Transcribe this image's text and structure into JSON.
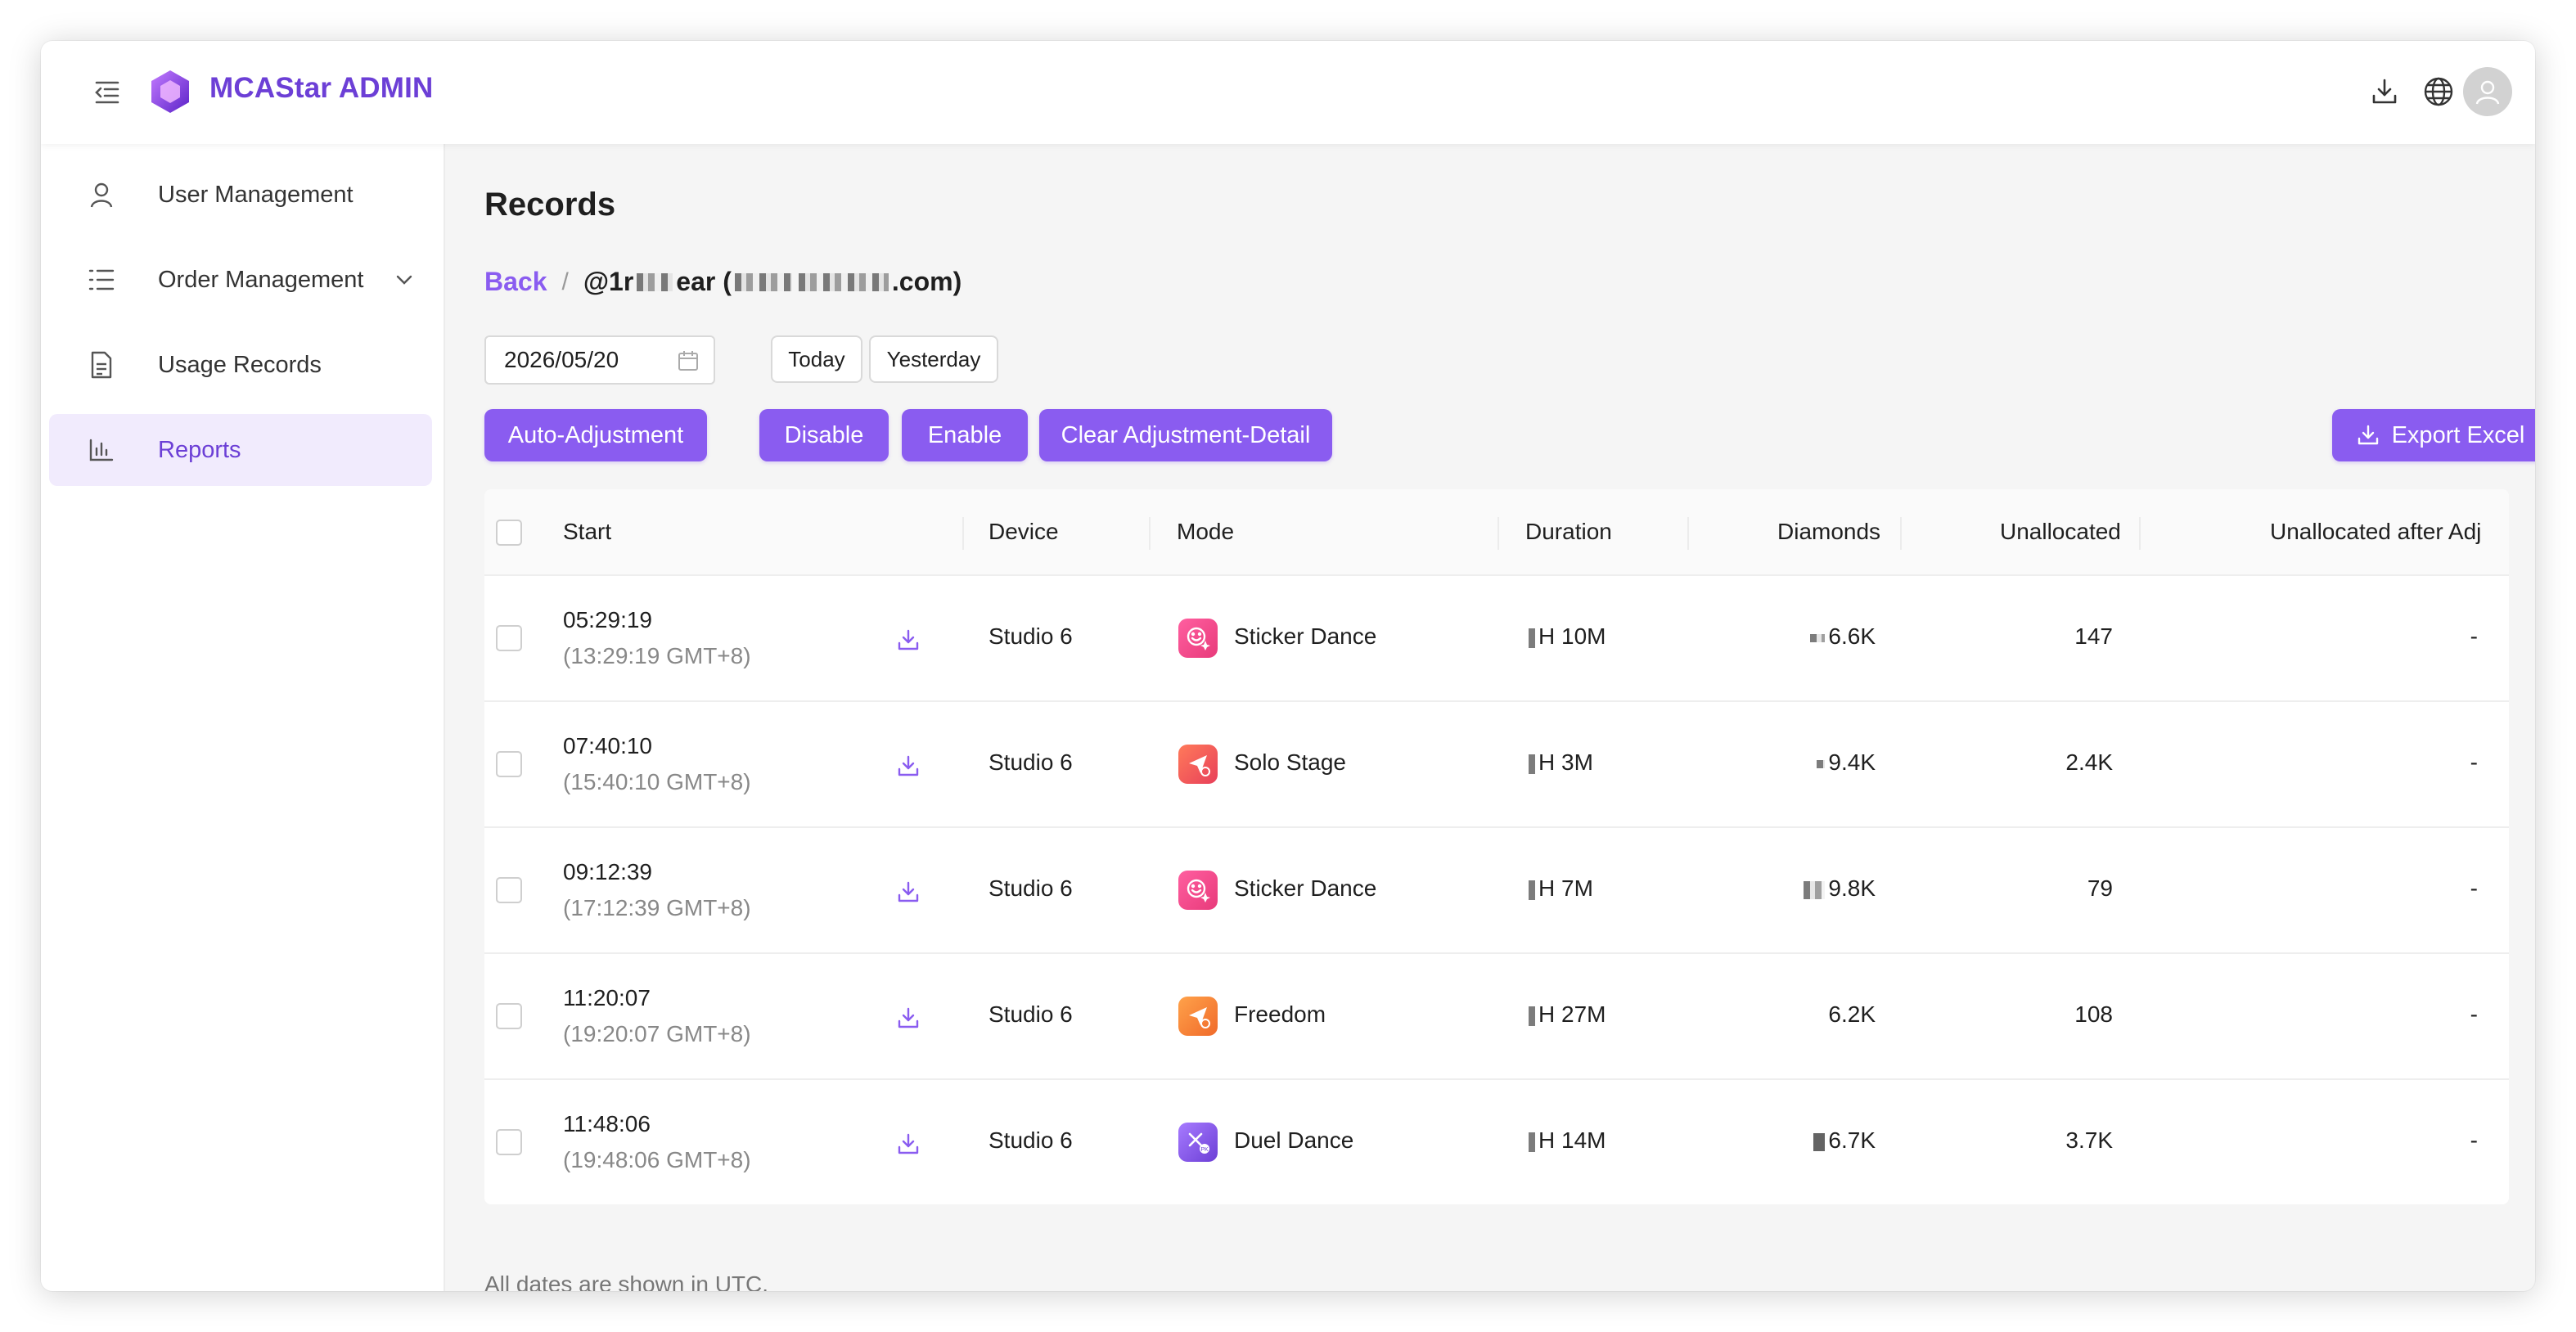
{
  "header": {
    "app_title": "MCAStar ADMIN",
    "icons": [
      "menu-fold-icon",
      "hexagon-logo-icon",
      "download-icon",
      "globe-icon",
      "user-avatar-icon"
    ]
  },
  "sidebar": {
    "items": [
      {
        "label": "User Management",
        "icon": "user-icon",
        "active": false
      },
      {
        "label": "Order Management",
        "icon": "list-icon",
        "active": false,
        "expandable": true
      },
      {
        "label": "Usage Records",
        "icon": "document-icon",
        "active": false
      },
      {
        "label": "Reports",
        "icon": "bar-chart-icon",
        "active": true
      }
    ]
  },
  "main": {
    "title": "Records",
    "breadcrumb": {
      "back": "Back",
      "separator": "/",
      "user_prefix": "@1r",
      "user_mid": "ear (",
      "user_suffix": ".com)"
    },
    "date_value": "2026/05/20",
    "quick_dates": [
      "Today",
      "Yesterday"
    ],
    "actions": {
      "auto_adjustment": "Auto-Adjustment",
      "disable": "Disable",
      "enable": "Enable",
      "clear_adjustment": "Clear Adjustment-Detail",
      "export_excel": "Export Excel"
    },
    "table": {
      "columns": {
        "start": "Start",
        "device": "Device",
        "mode": "Mode",
        "duration": "Duration",
        "diamonds": "Diamonds",
        "unallocated": "Unallocated",
        "unallocated_after": "Unallocated after Adj"
      },
      "rows": [
        {
          "time": "05:29:19",
          "local": "(13:29:19 GMT+8)",
          "device": "Studio 6",
          "mode": "Sticker Dance",
          "mode_color": "#f0508a",
          "duration": "H 10M",
          "diamonds": "6.6K",
          "unallocated": "147",
          "after": "-"
        },
        {
          "time": "07:40:10",
          "local": "(15:40:10 GMT+8)",
          "device": "Studio 6",
          "mode": "Solo Stage",
          "mode_color": "#f36a4a",
          "duration": "H 3M",
          "diamonds": "9.4K",
          "unallocated": "2.4K",
          "after": "-"
        },
        {
          "time": "09:12:39",
          "local": "(17:12:39 GMT+8)",
          "device": "Studio 6",
          "mode": "Sticker Dance",
          "mode_color": "#f0508a",
          "duration": "H 7M",
          "diamonds": "9.8K",
          "unallocated": "79",
          "after": "-"
        },
        {
          "time": "11:20:07",
          "local": "(19:20:07 GMT+8)",
          "device": "Studio 6",
          "mode": "Freedom",
          "mode_color": "#f5883a",
          "duration": "H 27M",
          "diamonds": "6.2K",
          "unallocated": "108",
          "after": "-"
        },
        {
          "time": "11:48:06",
          "local": "(19:48:06 GMT+8)",
          "device": "Studio 6",
          "mode": "Duel Dance",
          "mode_color": "#8a5cf0",
          "duration": "H 14M",
          "diamonds": "6.7K",
          "unallocated": "3.7K",
          "after": "-"
        }
      ]
    },
    "footer_note": "All dates are shown in UTC."
  },
  "colors": {
    "accent": "#8a5cf0",
    "brand_text": "#6c3fd6",
    "active_bg": "#f1ebfd"
  }
}
